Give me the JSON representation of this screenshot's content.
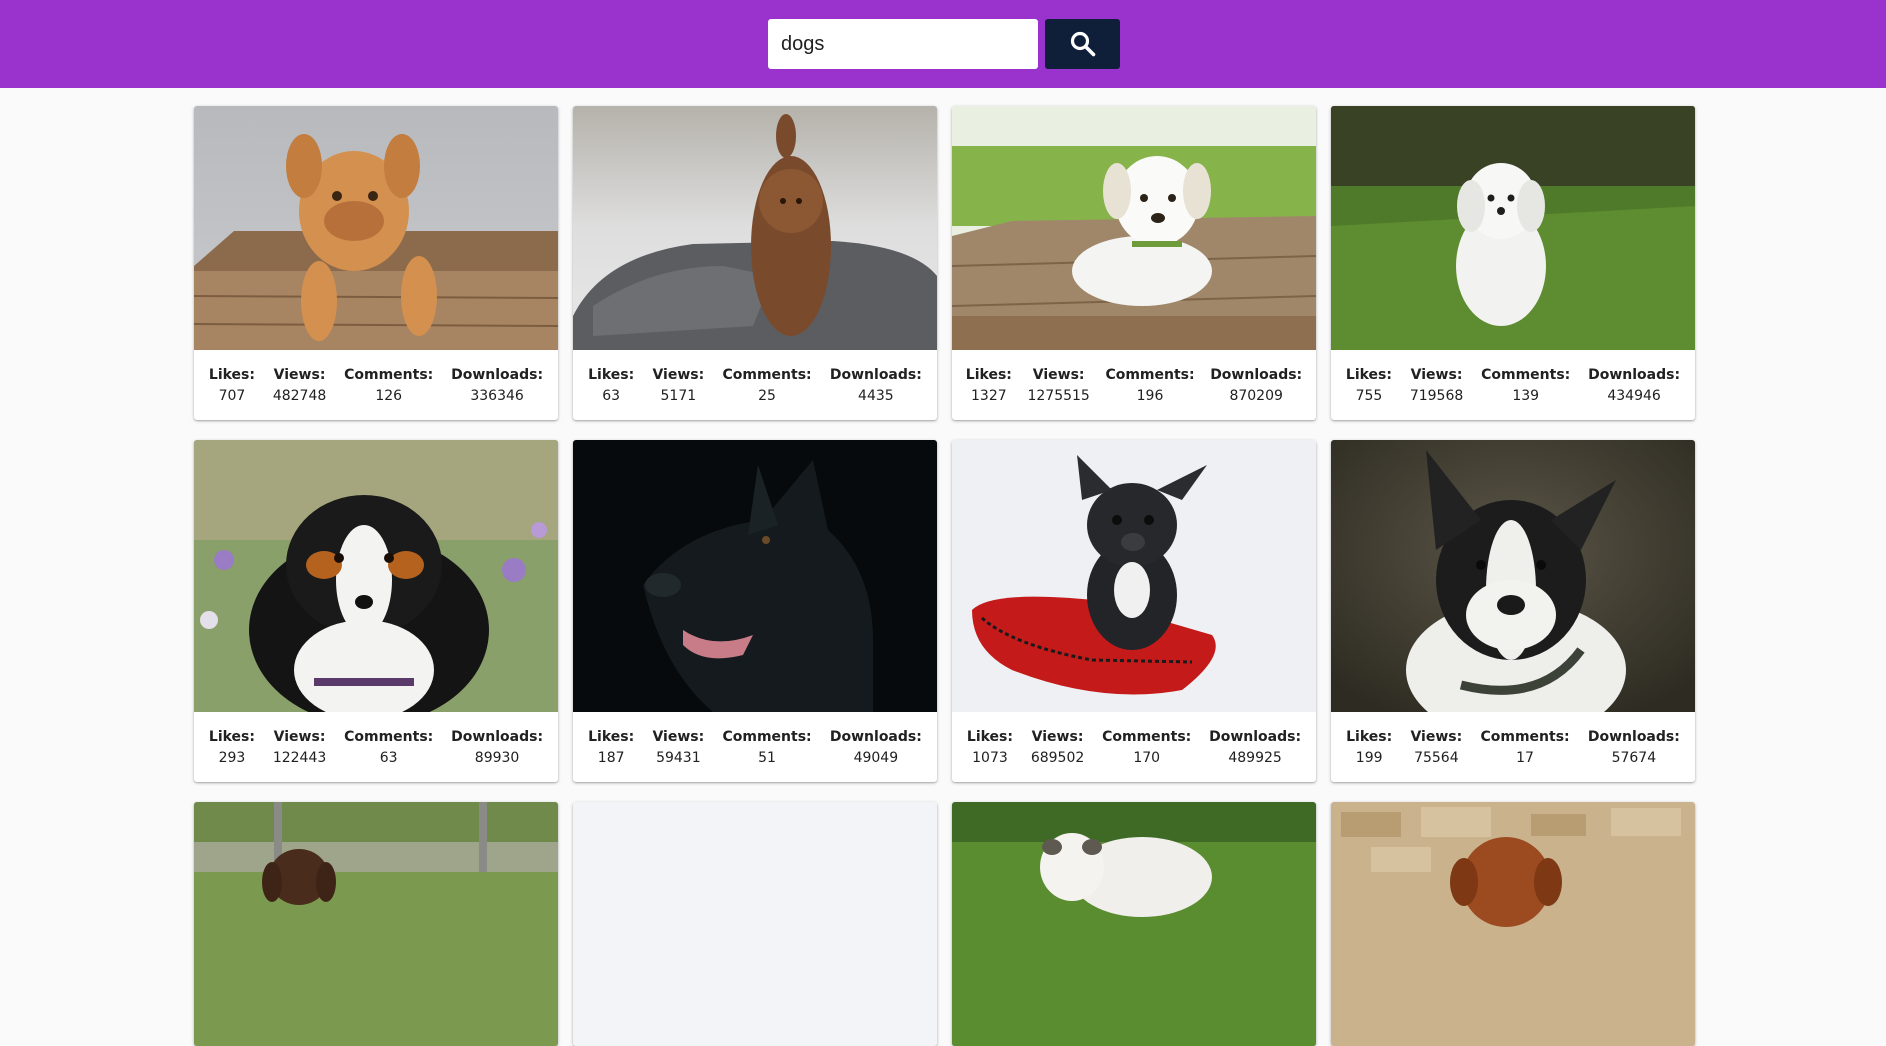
{
  "search": {
    "value": "dogs",
    "button_icon": "search-icon"
  },
  "colors": {
    "header": "#9a32cd",
    "search_button": "#0f1f3a",
    "page_background": "#fafafa"
  },
  "stat_labels": {
    "likes": "Likes:",
    "views": "Views:",
    "comments": "Comments:",
    "downloads": "Downloads:"
  },
  "images": [
    {
      "subject": "puppy-in-wooden-crate",
      "likes": "707",
      "views": "482748",
      "comments": "126",
      "downloads": "336346"
    },
    {
      "subject": "brown-shaggy-dog-on-rock",
      "likes": "63",
      "views": "5171",
      "comments": "25",
      "downloads": "4435"
    },
    {
      "subject": "white-puppy-on-wood",
      "likes": "1327",
      "views": "1275515",
      "comments": "196",
      "downloads": "870209"
    },
    {
      "subject": "white-dog-in-grass",
      "likes": "755",
      "views": "719568",
      "comments": "139",
      "downloads": "434946"
    },
    {
      "subject": "australian-shepherd",
      "likes": "293",
      "views": "122443",
      "comments": "63",
      "downloads": "89930"
    },
    {
      "subject": "black-dog-dark-background",
      "likes": "187",
      "views": "59431",
      "comments": "51",
      "downloads": "49049"
    },
    {
      "subject": "french-bulldog-on-red-pillow",
      "likes": "1073",
      "views": "689502",
      "comments": "170",
      "downloads": "489925"
    },
    {
      "subject": "boston-terrier",
      "likes": "199",
      "views": "75564",
      "comments": "17",
      "downloads": "57674"
    },
    {
      "subject": "brown-spaniel-in-yard"
    },
    {
      "subject": "blank-light-image"
    },
    {
      "subject": "bulldog-on-grass"
    },
    {
      "subject": "brown-dog-stone-wall"
    }
  ]
}
